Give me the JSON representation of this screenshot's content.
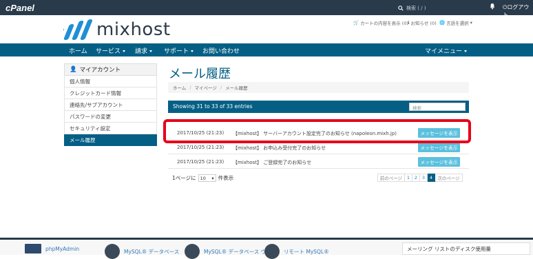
{
  "cpanel_bar": {
    "logo": "cPanel",
    "search_placeholder": "検索 ( / )",
    "account_label": "",
    "logout_label": "ログアウト"
  },
  "header": {
    "logo_text": "mixhost",
    "cart_label": "カートの内容を表示 (0)",
    "notices_label": "お知らせ (0)",
    "language_label": "言語を選択"
  },
  "nav": {
    "items": [
      "ホーム",
      "サービス",
      "請求",
      "サポート",
      "お問い合わせ"
    ],
    "my_menu": "マイメニュー"
  },
  "sidebar": {
    "title": "マイアカウント",
    "items": [
      "個人情報",
      "クレジットカード情報",
      "連絡先/サブアカウント",
      "パスワードの変更",
      "セキュリティ設定",
      "メール履歴"
    ],
    "active_index": 5
  },
  "page": {
    "title": "メール履歴",
    "breadcrumb": [
      "ホーム",
      "マイページ",
      "メール履歴"
    ]
  },
  "table": {
    "entries_text": "Showing 31 to 33 of 33 entries",
    "search_placeholder": "検索",
    "rows": [
      {
        "date": "2017/10/25 (21:23)",
        "subject": "【mixhost】 サーバーアカウント設定完了のお知らせ (napoleon.mixh.jp)",
        "button": "メッセージを表示"
      },
      {
        "date": "2017/10/25 (21:23)",
        "subject": "【mixhost】 お申込み受付完了のお知らせ",
        "button": "メッセージを表示"
      },
      {
        "date": "2017/10/25 (21:23)",
        "subject": "【mixhost】 ご登録完了のお知らせ",
        "button": "メッセージを表示"
      }
    ]
  },
  "pagination": {
    "per_page_prefix": "1ページに",
    "per_page_value": "10",
    "per_page_suffix": "件表示",
    "prev": "前のページ",
    "pages": [
      "1",
      "2",
      "3",
      "4"
    ],
    "current": "4",
    "next": "次のページ"
  },
  "footer": {
    "items": [
      "phpMyAdmin",
      "MySQL® データベース",
      "MySQL® データベース ウィザ",
      "リモート MySQL®"
    ],
    "panel_title": "メーリング リストのディスク使用量"
  },
  "colors": {
    "brand_blue": "#055f85",
    "cpanel_dark": "#293a4a",
    "button_info": "#5bc0de",
    "highlight_red": "#e6001a"
  }
}
